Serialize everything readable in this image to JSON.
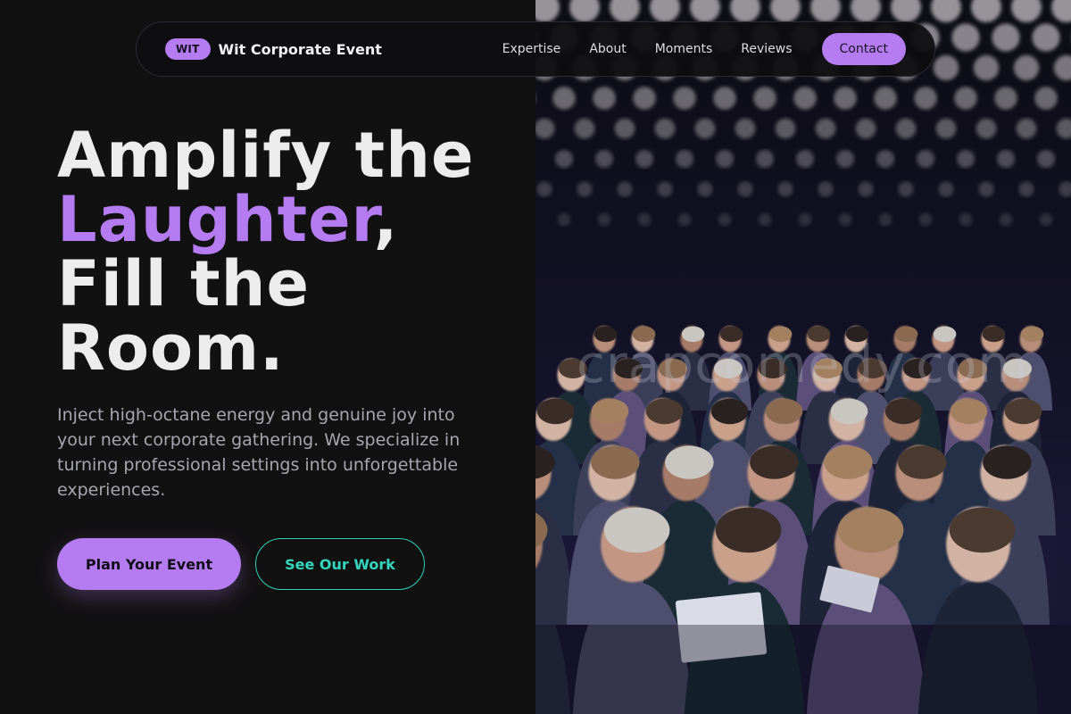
{
  "nav": {
    "badge": "WIT",
    "brand": "Wit Corporate Event",
    "links": [
      "Expertise",
      "About",
      "Moments",
      "Reviews"
    ],
    "cta": "Contact"
  },
  "hero": {
    "line1": "Amplify the",
    "accent_word": "Laughter",
    "accent_suffix": ",",
    "line3": "Fill the",
    "line4": "Room.",
    "description": "Inject high-octane energy and genuine joy into your next corporate gathering. We specialize in turning professional settings into unforgettable experiences.",
    "primary_button": "Plan Your Event",
    "secondary_button": "See Our Work"
  },
  "photo": {
    "watermark": "crapcomedy.com",
    "subject": "audience seated at a corporate event under a ceiling of lights"
  },
  "colors": {
    "background": "#121112",
    "accent_purple": "#b57cf2",
    "accent_teal": "#2fd1b8",
    "text": "#ececec",
    "muted": "#a6a6ae"
  }
}
